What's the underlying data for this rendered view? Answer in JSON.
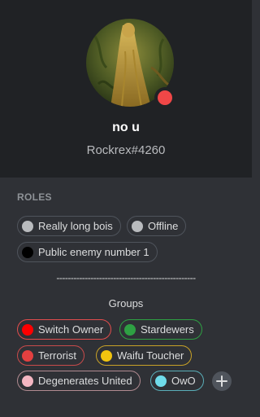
{
  "profile": {
    "username": "no u",
    "tag": "Rockrex#4260",
    "status": "dnd",
    "status_color": "#f04747"
  },
  "roles_section": {
    "title": "ROLES",
    "roles": [
      {
        "label": "Really long bois",
        "color": "#b9bbbe",
        "border": "#4f545c"
      },
      {
        "label": "Offline",
        "color": "#b9bbbe",
        "border": "#4f545c"
      },
      {
        "label": "Public enemy number 1",
        "color": "#000000",
        "border": "#4f545c"
      }
    ],
    "separator_text": "-------------------------------------------------",
    "groups_label": "Groups",
    "groups": [
      {
        "label": "Switch Owner",
        "color": "#ff0000",
        "border": "#e34d4d"
      },
      {
        "label": "Stardewers",
        "color": "#2ea043",
        "border": "#2ea043"
      },
      {
        "label": "Terrorist",
        "color": "#e34040",
        "border": "#c94b4b"
      },
      {
        "label": "Waifu Toucher",
        "color": "#f1c40f",
        "border": "#c9a227"
      },
      {
        "label": "Degenerates United",
        "color": "#f4b6c2",
        "border": "#b08a90"
      },
      {
        "label": "OwO",
        "color": "#6fdcea",
        "border": "#5aaeb8"
      }
    ],
    "add_button_icon": "plus-icon"
  }
}
